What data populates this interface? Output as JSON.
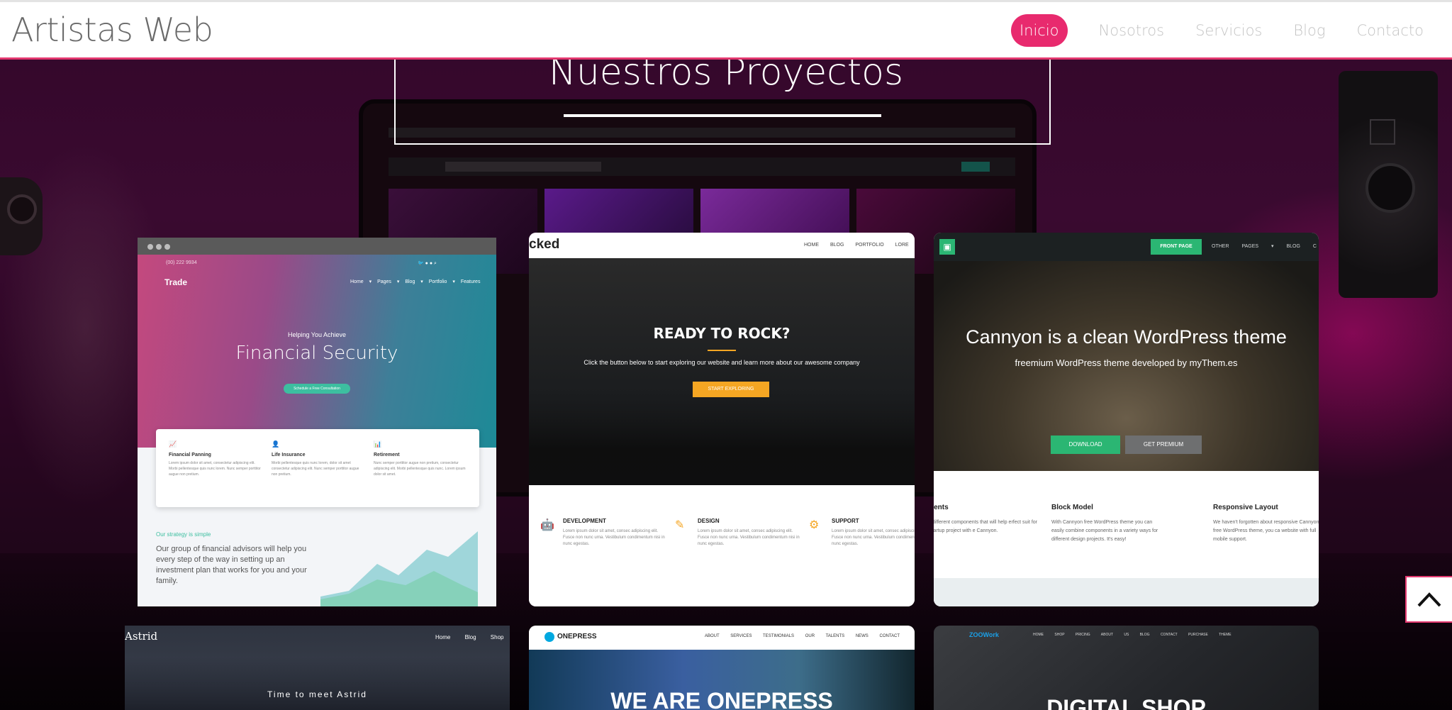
{
  "navbar": {
    "brand": "Artistas Web",
    "items": [
      {
        "label": "Inicio",
        "active": true
      },
      {
        "label": "Nosotros",
        "active": false
      },
      {
        "label": "Servicios",
        "active": false
      },
      {
        "label": "Blog",
        "active": false
      },
      {
        "label": "Contacto",
        "active": false
      }
    ],
    "accent_color": "#e82a6e"
  },
  "section": {
    "title": "Nuestros Proyectos"
  },
  "projects": {
    "trade": {
      "phone": "(00) 222 9934",
      "logo": "Trade",
      "menu": "Home ▾  Pages ▾  Blog ▾  Portfolio ▾  Features",
      "sub": "Helping You Achieve",
      "headline": "Financial Security",
      "cta": "Schedule a Free Consultation",
      "features": [
        {
          "title": "Financial Panning",
          "text": "Lorem ipsum dolor sit amet, consectetur adipiscing elit. Morbi pellentesque quis nunc lorem. Nunc semper porttitor augue non pretium."
        },
        {
          "title": "Life Insurance",
          "text": "Morbi pellentesque quis nunc lorem, dolor sit amet consectetur adipiscing elit. Nunc semper porttitor augue non pretium."
        },
        {
          "title": "Retirement",
          "text": "Nunc semper porttitor augue non pretium, consectetur adipiscing elit. Morbi pellentesque quis nunc. Lorem ipsum dolor sit amet."
        }
      ],
      "strategy": "Our strategy is simple",
      "blurb": "Our group of financial advisors will help you every step of the way in setting up an investment plan that works for you and your family."
    },
    "wicked": {
      "logo": "cked",
      "menu": "HOME  BLOG  PORTFOLIO  LORE",
      "headline": "READY TO ROCK?",
      "text": "Click the button below to start exploring our website and learn more about our awesome company",
      "cta": "START EXPLORING",
      "features": [
        {
          "title": "DEVELOPMENT",
          "icon": "android-icon",
          "text": "Lorem ipsum dolor sit amet, consec adipiscing elit. Fusce non nunc urna. Vestibulum condimentum nisi in nunc egestas."
        },
        {
          "title": "DESIGN",
          "icon": "pencil-icon",
          "text": "Lorem ipsum dolor sit amet, consec adipiscing elit. Fusce non nunc urna. Vestibulum condimentum nisi in nunc egestas."
        },
        {
          "title": "SUPPORT",
          "icon": "gears-icon",
          "text": "Lorem ipsum dolor sit amet, consec adipiscing elit. Fusce non nunc urna. Vestibulum condimentum nisi in nunc egestas."
        }
      ]
    },
    "cannyon": {
      "front_page": "FRONT PAGE",
      "menu": "OTHER PAGES ▾  BLOG  C",
      "headline": "Cannyon is a clean WordPress theme",
      "sub": "freemium WordPress theme developed by myThem.es",
      "download": "DOWNLOAD",
      "premium": "GET PREMIUM",
      "columns": [
        {
          "title": "nents",
          "text": "f different components that will help erfect suit for startup project with e Cannyon."
        },
        {
          "title": "Block Model",
          "text": "With Cannyon free WordPress theme you can easily combine components in a variety ways for different design projects. It's easy!"
        },
        {
          "title": "Responsive Layout",
          "text": "We haven't forgotten about responsive Cannyon free WordPress theme, you ca website with full mobile support."
        }
      ]
    },
    "astrid": {
      "logo": "Astrid",
      "menu": "Home  Blog  Shop",
      "tagline": "Time to meet Astrid"
    },
    "onepress": {
      "name": "ONEPRESS",
      "menu": "ABOUT  SERVICES  TESTIMONIALS  OUR TALENTS  NEWS  CONTACT",
      "headline": "WE ARE ONEPRESS"
    },
    "shop": {
      "logo": "ZOOWork",
      "menu": "HOME  SHOP  PRICING  ABOUT US  BLOG  CONTACT  PURCHASE THEME",
      "headline": "DIGITAL SHOP"
    }
  },
  "back_to_top": {
    "icon": "chevron-up-icon"
  }
}
